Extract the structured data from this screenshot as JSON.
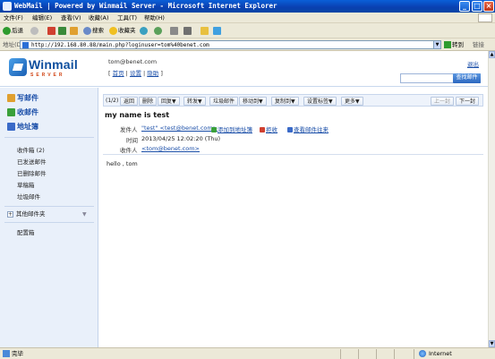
{
  "window": {
    "title": "WebMail | Powered by Winmail Server - Microsoft Internet Explorer"
  },
  "menu": [
    "文件(F)",
    "编辑(E)",
    "查看(V)",
    "收藏(A)",
    "工具(T)",
    "帮助(H)"
  ],
  "toolbar": {
    "back": "后退",
    "search": "搜索",
    "favorites": "收藏夹"
  },
  "address": {
    "label": "地址(D)",
    "url": "http://192.168.80.88/main.php?loginuser=tom%40benet.com",
    "go": "转到",
    "links": "链接"
  },
  "header": {
    "logo_word": "Winmail",
    "logo_sub": "SERVER",
    "user_email": "tom@benet.com",
    "link_home": "首页",
    "link_settings": "设置",
    "link_help": "隐助",
    "logout": "退出",
    "search_button": "查找邮件"
  },
  "sidebar": {
    "compose": "写邮件",
    "inbox_check": "收邮件",
    "address_book": "地址簿",
    "folders": [
      "收件箱 (2)",
      "已发送邮件",
      "已删除邮件",
      "草稿箱",
      "垃圾邮件"
    ],
    "other_folders": "其他邮件夹",
    "settings_folder": "配置箱"
  },
  "mail_toolbar": {
    "counter": "(1/2)",
    "buttons": [
      "返回",
      "删除",
      "回复▼",
      "转发▼",
      "垃圾邮件",
      "移动到▼",
      "复制到▼",
      "设置标签▼",
      "更多▼"
    ],
    "prev": "上一封",
    "next": "下一封"
  },
  "message": {
    "subject": "my name is test",
    "from_label": "发件人",
    "from_value": "\"test\" <test@benet.com>",
    "actions": [
      "添加到地址簿",
      "拒收",
      "查看邮件往来"
    ],
    "time_label": "时间",
    "time_value": "2013/04/25 12:02:20 (Thu)",
    "to_label": "收件人",
    "to_value": "<tom@benet.com>",
    "body": "hello , tom"
  },
  "status": {
    "left": "完毕",
    "zone": "Internet"
  }
}
